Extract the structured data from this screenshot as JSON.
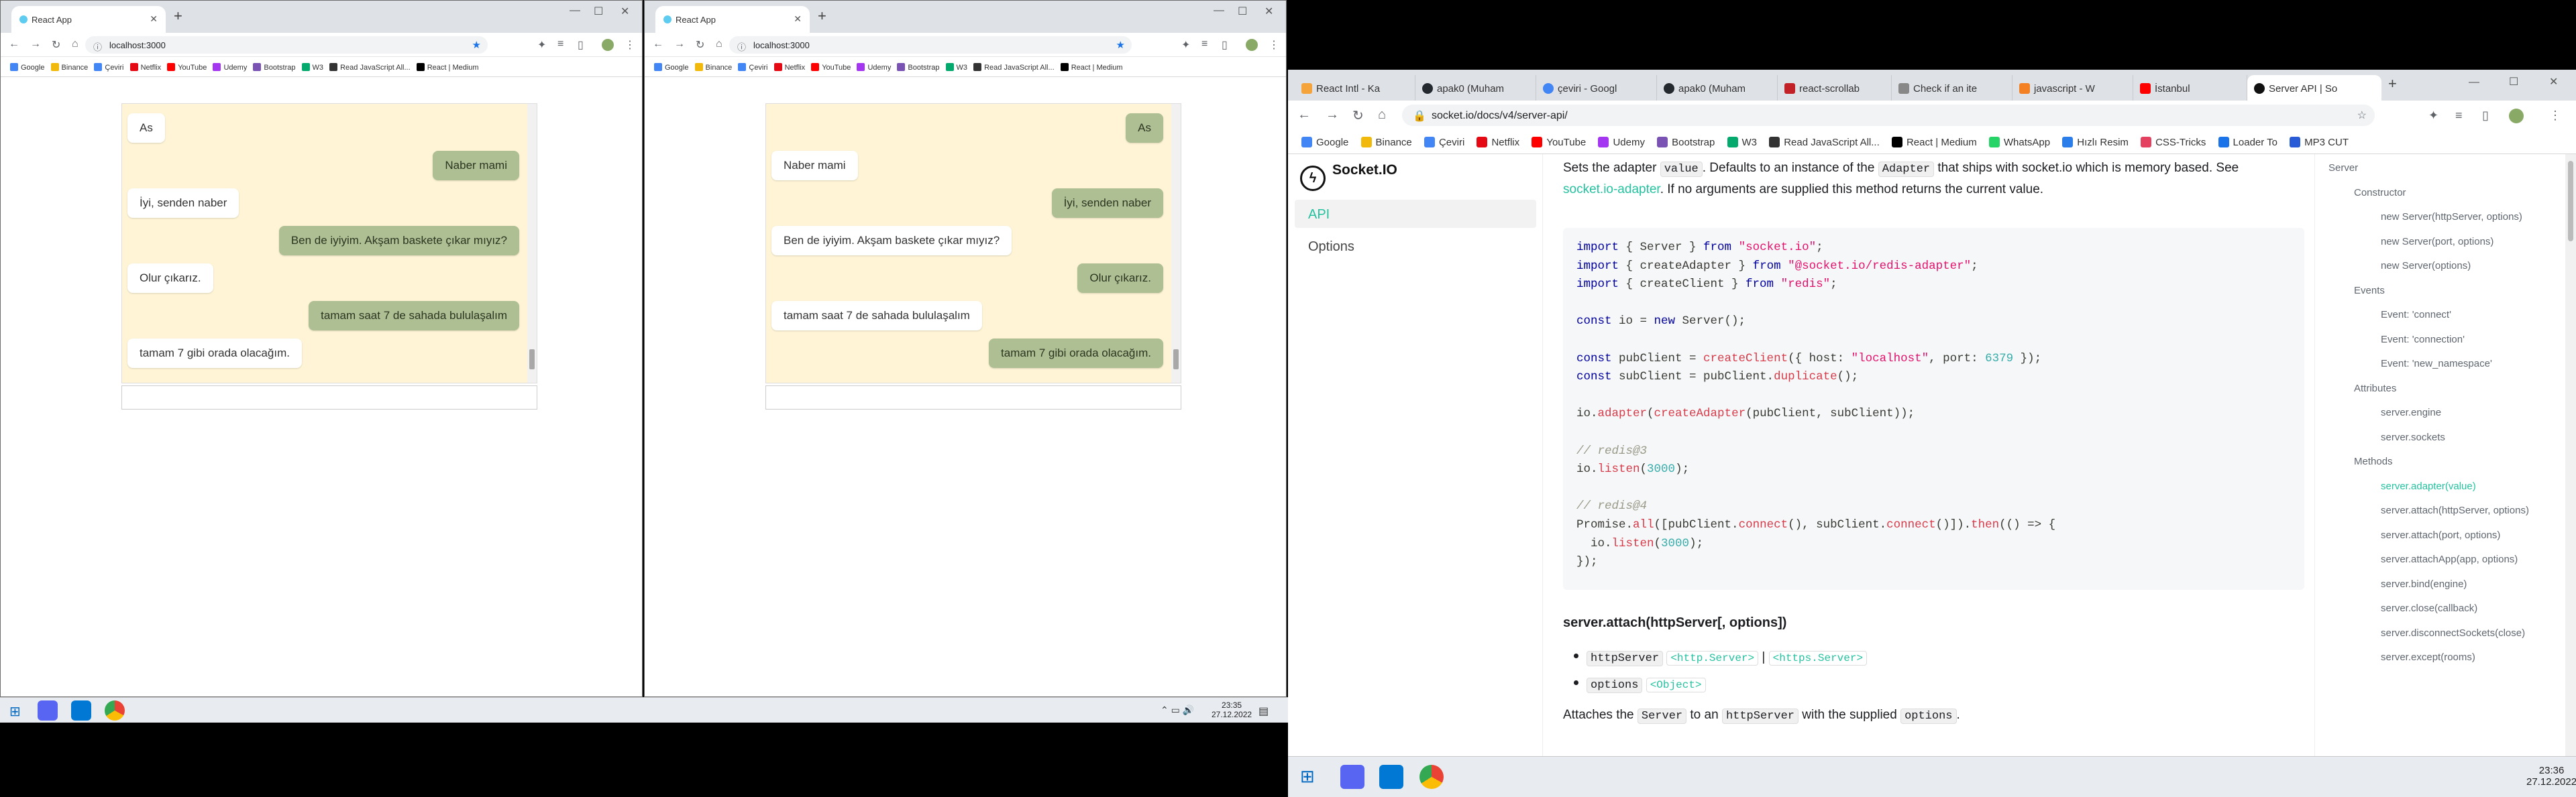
{
  "left_window_1": {
    "tab_title": "React App",
    "url": "localhost:3000",
    "bookmarks": [
      "Google",
      "Binance",
      "Çeviri",
      "Netflix",
      "YouTube",
      "Udemy",
      "Bootstrap",
      "W3",
      "Read JavaScript All...",
      "React | Medium"
    ],
    "messages": [
      {
        "text": "As",
        "dir": "in"
      },
      {
        "text": "Naber mami",
        "dir": "out"
      },
      {
        "text": "İyi, senden naber",
        "dir": "in"
      },
      {
        "text": "Ben de iyiyim. Akşam baskete çıkar mıyız?",
        "dir": "out"
      },
      {
        "text": "Olur çıkarız.",
        "dir": "in"
      },
      {
        "text": "tamam saat 7 de sahada bululaşalım",
        "dir": "out"
      },
      {
        "text": "tamam 7 gibi orada olacağım.",
        "dir": "in"
      }
    ]
  },
  "left_window_2": {
    "tab_title": "React App",
    "url": "localhost:3000",
    "bookmarks": [
      "Google",
      "Binance",
      "Çeviri",
      "Netflix",
      "YouTube",
      "Udemy",
      "Bootstrap",
      "W3",
      "Read JavaScript All...",
      "React | Medium"
    ],
    "messages": [
      {
        "text": "As",
        "dir": "out"
      },
      {
        "text": "Naber mami",
        "dir": "in"
      },
      {
        "text": "İyi, senden naber",
        "dir": "out"
      },
      {
        "text": "Ben de iyiyim. Akşam baskete çıkar mıyız?",
        "dir": "in"
      },
      {
        "text": "Olur çıkarız.",
        "dir": "out"
      },
      {
        "text": "tamam saat 7 de sahada bululaşalım",
        "dir": "in"
      },
      {
        "text": "tamam 7 gibi orada olacağım.",
        "dir": "out"
      }
    ]
  },
  "left_taskbar": {
    "time": "23:35",
    "date": "27.12.2022"
  },
  "right_window": {
    "tabs": [
      "React Intl - Ka",
      "apak0 (Muham",
      "çeviri - Googl",
      "apak0 (Muham",
      "react-scrollab",
      "Check if an ite",
      "javascript - W",
      "İstanbul",
      "Server API | So"
    ],
    "url": "socket.io/docs/v4/server-api/",
    "bookmarks": [
      "Google",
      "Binance",
      "Çeviri",
      "Netflix",
      "YouTube",
      "Udemy",
      "Bootstrap",
      "W3",
      "Read JavaScript All...",
      "React | Medium",
      "WhatsApp",
      "Hızlı Resim",
      "CSS-Tricks",
      "Loader To",
      "MP3 CUT"
    ],
    "logo": "Socket.IO",
    "nav": [
      "API",
      "Options"
    ],
    "intro_1": "Sets the adapter",
    "intro_code_1": "value",
    "intro_2": ". Defaults to an instance of the",
    "intro_code_2": "Adapter",
    "intro_3": "that ships with socket.io which is memory based. See",
    "intro_link": "socket.io-adapter",
    "intro_4": ". If no arguments are supplied this method returns the current value.",
    "heading": "server.attach(httpServer[, options])",
    "bullets": [
      {
        "code": "httpServer",
        "types": [
          "<http.Server>",
          "<https.Server>"
        ]
      },
      {
        "code": "options",
        "types": [
          "<Object>"
        ]
      }
    ],
    "attaches_1": "Attaches the",
    "attaches_code_1": "Server",
    "attaches_2": "to an",
    "attaches_code_2": "httpServer",
    "attaches_3": "with the supplied",
    "attaches_code_3": "options",
    "attaches_4": ".",
    "toc": [
      {
        "t": "Server",
        "lvl": 0
      },
      {
        "t": "Constructor",
        "lvl": 1
      },
      {
        "t": "new Server(httpServer, options)",
        "lvl": 2
      },
      {
        "t": "new Server(port, options)",
        "lvl": 2
      },
      {
        "t": "new Server(options)",
        "lvl": 2
      },
      {
        "t": "Events",
        "lvl": 1
      },
      {
        "t": "Event: 'connect'",
        "lvl": 2
      },
      {
        "t": "Event: 'connection'",
        "lvl": 2
      },
      {
        "t": "Event: 'new_namespace'",
        "lvl": 2
      },
      {
        "t": "Attributes",
        "lvl": 1
      },
      {
        "t": "server.engine",
        "lvl": 2
      },
      {
        "t": "server.sockets",
        "lvl": 2
      },
      {
        "t": "Methods",
        "lvl": 1
      },
      {
        "t": "server.adapter(value)",
        "lvl": 2,
        "active": true
      },
      {
        "t": "server.attach(httpServer, options)",
        "lvl": 2
      },
      {
        "t": "server.attach(port, options)",
        "lvl": 2
      },
      {
        "t": "server.attachApp(app, options)",
        "lvl": 2
      },
      {
        "t": "server.bind(engine)",
        "lvl": 2
      },
      {
        "t": "server.close(callback)",
        "lvl": 2
      },
      {
        "t": "server.disconnectSockets(close)",
        "lvl": 2
      },
      {
        "t": "server.except(rooms)",
        "lvl": 2
      }
    ]
  },
  "right_taskbar": {
    "time": "23:36",
    "date": "27.12.2022"
  },
  "colors": {
    "accent": "#25c2a0",
    "bubble_out": "#aebf94",
    "chat_bg": "#fff5d6"
  }
}
